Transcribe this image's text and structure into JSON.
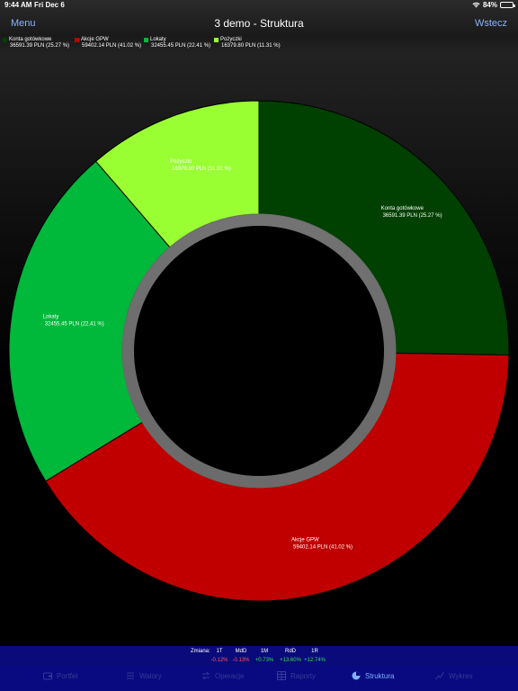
{
  "status_bar": {
    "time": "9:44 AM",
    "date": "Fri Dec 6",
    "battery": "84%",
    "battery_level": 0.84
  },
  "nav": {
    "menu_label": "Menu",
    "title": "3 demo - Struktura",
    "back_label": "Wstecz"
  },
  "legend": [
    {
      "name": "Konta gotówkowe",
      "value": "36591.39 PLN (25.27 %)",
      "color": "#004000"
    },
    {
      "name": "Akcje GPW",
      "value": "59402.14 PLN (41.02 %)",
      "color": "#c00000"
    },
    {
      "name": "Lokaty",
      "value": "32455.45 PLN (22.41 %)",
      "color": "#00b83a"
    },
    {
      "name": "Pożyczki",
      "value": "16379.80 PLN (11.31 %)",
      "color": "#99ff33"
    }
  ],
  "chart_data": {
    "type": "pie",
    "variant": "donut",
    "start": "top, clockwise",
    "slices": [
      {
        "label": "Konta gotówkowe",
        "value": 36591.39,
        "percent": 25.27,
        "text": "36591.39 PLN (25.27 %)",
        "color": "#004000",
        "text_color": "#ffffff"
      },
      {
        "label": "Akcje GPW",
        "value": 59402.14,
        "percent": 41.02,
        "text": "59402.14 PLN (41.02 %)",
        "color": "#c00000",
        "text_color": "#ffffff"
      },
      {
        "label": "Lokaty",
        "value": 32455.45,
        "percent": 22.41,
        "text": "32455.45 PLN (22.41 %)",
        "color": "#00b83a",
        "text_color": "#ffffff"
      },
      {
        "label": "Pożyczki",
        "value": 16379.8,
        "percent": 11.31,
        "text": "16379.80 PLN (11.31 %)",
        "color": "#99ff33",
        "text_color": "#ffffff"
      }
    ]
  },
  "change": {
    "label": "Zmiana:",
    "items": [
      {
        "period": "1T",
        "value": "-0.12%",
        "color": "#ff5555"
      },
      {
        "period": "MdD",
        "value": "-0.13%",
        "color": "#ff5555"
      },
      {
        "period": "1M",
        "value": "+0.73%",
        "color": "#33dd55"
      },
      {
        "period": "RdD",
        "value": "+13.60%",
        "color": "#33dd55"
      },
      {
        "period": "1R",
        "value": "+12.74%",
        "color": "#33dd55"
      }
    ]
  },
  "tabs": [
    {
      "label": "Portfel",
      "icon": "wallet-icon",
      "active": false
    },
    {
      "label": "Walory",
      "icon": "list-icon",
      "active": false
    },
    {
      "label": "Operacje",
      "icon": "exchange-icon",
      "active": false
    },
    {
      "label": "Raporty",
      "icon": "table-icon",
      "active": false
    },
    {
      "label": "Struktura",
      "icon": "pie-chart-icon",
      "active": true
    },
    {
      "label": "Wykres",
      "icon": "line-chart-icon",
      "active": false
    }
  ]
}
